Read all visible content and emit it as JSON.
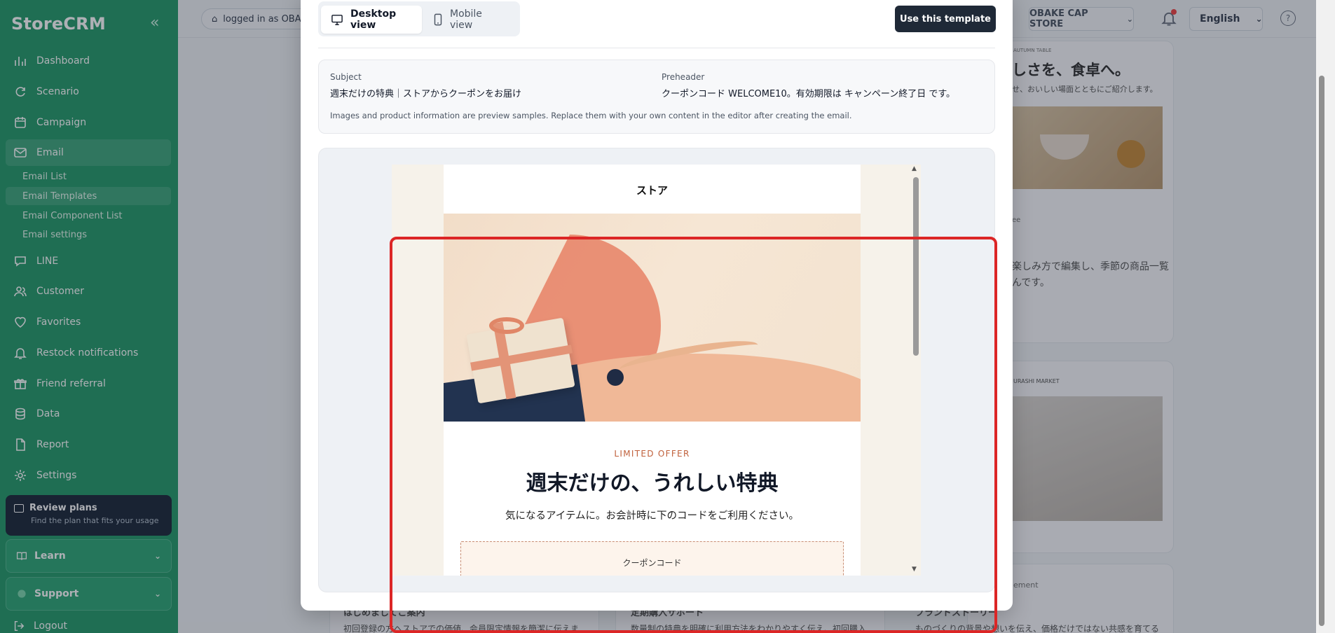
{
  "sidebar": {
    "brand": "StoreCRM",
    "collapse_icon": "«",
    "items": [
      {
        "label": "Dashboard",
        "icon": "bar-chart-icon"
      },
      {
        "label": "Scenario",
        "icon": "refresh-icon"
      },
      {
        "label": "Campaign",
        "icon": "calendar-icon"
      },
      {
        "label": "Email",
        "icon": "mail-icon"
      },
      {
        "label": "LINE",
        "icon": "chat-icon"
      },
      {
        "label": "Customer",
        "icon": "users-icon"
      },
      {
        "label": "Favorites",
        "icon": "heart-icon"
      },
      {
        "label": "Restock notifications",
        "icon": "bell-icon"
      },
      {
        "label": "Friend referral",
        "icon": "gift-icon"
      },
      {
        "label": "Data",
        "icon": "database-icon"
      },
      {
        "label": "Report",
        "icon": "file-icon"
      },
      {
        "label": "Settings",
        "icon": "gear-icon"
      }
    ],
    "email_sub": [
      "Email List",
      "Email Templates",
      "Email Component List",
      "Email settings"
    ],
    "plans": {
      "title": "Review plans",
      "subtitle": "Find the plan that fits your usage"
    },
    "learn": "Learn",
    "support": "Support",
    "logout": "Logout"
  },
  "topbar": {
    "login": "logged in as OBA",
    "store": "OBAKE CAP STORE",
    "language": "English",
    "help": "?"
  },
  "background": {
    "card1_title": "しさを、食卓へ。",
    "card1_sub": "せ、おいしい場面とともにご紹介します。",
    "card1_small": "AUTUMN TABLE",
    "card1_tag": "ee",
    "card1_body1": "楽しみ方で編集し、季節の商品一覧",
    "card1_body2": "んです。",
    "card2_small": "URASHI MARKET",
    "card3_small": "ement",
    "bottom1": "はじめましてご案内",
    "bottom2": "初回登録の方へストアでの価値、会員限定情報を簡潔に伝えま",
    "bottom3": "定期購入サポート",
    "bottom4": "数量制の特典を明確に利用方法をわかりやすく伝え、初回購入",
    "bottom5": "ブランドストーリー",
    "bottom6": "ものづくりの背景や想いを伝え、価格だけではない共感を育てる"
  },
  "modal": {
    "tabs": [
      {
        "label": "Desktop view",
        "icon": "monitor-icon"
      },
      {
        "label": "Mobile view",
        "icon": "phone-icon"
      }
    ],
    "use_template": "Use this template",
    "subject_label": "Subject",
    "subject_value": "週末だけの特典｜ストアからクーポンをお届け",
    "preheader_label": "Preheader",
    "preheader_value": "クーポンコード WELCOME10。有効期限は キャンペーン終了日 です。",
    "note": "Images and product information are preview samples. Replace them with your own content in the editor after creating the email."
  },
  "email": {
    "store": "ストア",
    "hero_alt": "gift-box-hero-image",
    "offer": "LIMITED OFFER",
    "headline": "週末だけの、うれしい特典",
    "sub": "気になるアイテムに。お会計時に下のコードをご利用ください。",
    "coupon_label": "クーポンコード"
  },
  "colors": {
    "sidebar": "#279c6b",
    "primary_button": "#1f2937",
    "accent": "#c0603b",
    "highlight": "#dc2626"
  }
}
